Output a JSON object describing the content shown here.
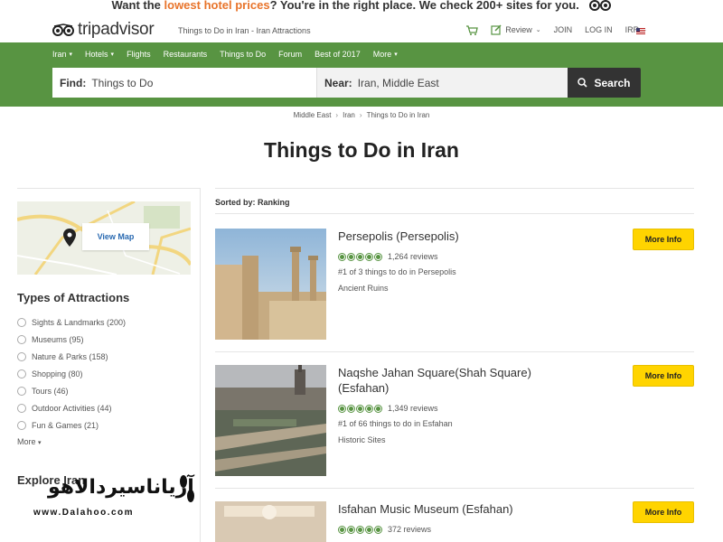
{
  "promo": {
    "before": "Want the ",
    "highlight": "lowest hotel prices",
    "after": "? You're in the right place. We check 200+ sites for you."
  },
  "header": {
    "logo_text": "tripadvisor",
    "subtitle": "Things to Do in Iran - Iran Attractions",
    "review_label": "Review",
    "join_label": "JOIN",
    "login_label": "LOG IN",
    "currency": "IRR"
  },
  "nav": {
    "items": [
      {
        "label": "Iran",
        "caret": true
      },
      {
        "label": "Hotels",
        "caret": true
      },
      {
        "label": "Flights",
        "caret": false
      },
      {
        "label": "Restaurants",
        "caret": false
      },
      {
        "label": "Things to Do",
        "caret": false
      },
      {
        "label": "Forum",
        "caret": false
      },
      {
        "label": "Best of 2017",
        "caret": false
      },
      {
        "label": "More",
        "caret": true
      }
    ]
  },
  "search": {
    "find_label": "Find:",
    "find_value": "Things to Do",
    "near_label": "Near:",
    "near_value": "Iran, Middle East",
    "button_label": "Search"
  },
  "breadcrumb": [
    "Middle East",
    "Iran",
    "Things to Do in Iran"
  ],
  "page_title": "Things to Do in Iran",
  "sidebar": {
    "view_map": "View Map",
    "types_heading": "Types of Attractions",
    "categories": [
      "Sights & Landmarks (200)",
      "Museums (95)",
      "Nature & Parks (158)",
      "Shopping (80)",
      "Tours (46)",
      "Outdoor Activities (44)",
      "Fun & Games (21)"
    ],
    "more_label": "More",
    "explore_heading": "Explore Iran"
  },
  "sort": {
    "label": "Sorted by: Ranking"
  },
  "attractions": [
    {
      "name": "Persepolis (Persepolis)",
      "reviews": "1,264 reviews",
      "rank": "#1 of 3 things to do in Persepolis",
      "type": "Ancient Ruins",
      "rating": 5,
      "button": "More Info"
    },
    {
      "name": "Naqshe Jahan Square(Shah Square) (Esfahan)",
      "reviews": "1,349 reviews",
      "rank": "#1 of 66 things to do in Esfahan",
      "type": "Historic Sites",
      "rating": 5,
      "button": "More Info"
    },
    {
      "name": "Isfahan Music Museum (Esfahan)",
      "reviews": "372 reviews",
      "rank": "",
      "type": "",
      "rating": 5,
      "button": "More Info"
    }
  ],
  "watermark": {
    "fa": "آریاناسیردالاهو",
    "url": "www.Dalahoo.com"
  },
  "colors": {
    "brand_green": "#589442",
    "promo_orange": "#e8742b",
    "button_yellow": "#ffd400",
    "search_button": "#333333",
    "link_blue": "#2a6ab1"
  }
}
